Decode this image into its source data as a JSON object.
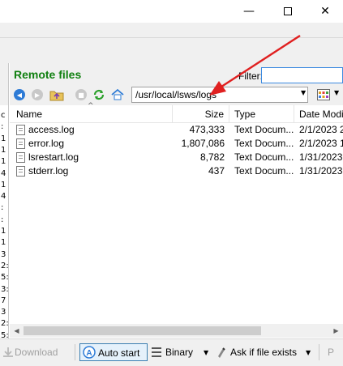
{
  "window": {
    "minimize_glyph": "—",
    "close_glyph": "✕"
  },
  "left_panel": {
    "clipped_chars": [
      "c",
      ":",
      "1",
      "1",
      "1",
      "4",
      "1",
      "4",
      ":",
      ":",
      "1",
      "1",
      "3",
      "2:",
      "5:",
      "3:",
      "7",
      "3",
      "2:",
      "5:",
      "4:"
    ]
  },
  "remote": {
    "title": "Remote files",
    "filter_label": "Filter:",
    "filter_value": "",
    "path": "/usr/local/lsws/logs",
    "toolbar_icons": [
      "back-icon",
      "forward-icon",
      "parent-folder-icon",
      "stop-icon",
      "refresh-icon",
      "home-icon",
      "view-mode-icon"
    ],
    "columns": {
      "name": "Name",
      "size": "Size",
      "type": "Type",
      "date": "Date Modifi"
    },
    "files": [
      {
        "name": "access.log",
        "size": "473,333",
        "type": "Text Docum...",
        "date": "2/1/2023 2"
      },
      {
        "name": "error.log",
        "size": "1,807,086",
        "type": "Text Docum...",
        "date": "2/1/2023 1"
      },
      {
        "name": "lsrestart.log",
        "size": "8,782",
        "type": "Text Docum...",
        "date": "1/31/2023"
      },
      {
        "name": "stderr.log",
        "size": "437",
        "type": "Text Docum...",
        "date": "1/31/2023"
      }
    ]
  },
  "bottom_toolbar": {
    "download": "Download",
    "auto_start": "Auto start",
    "binary": "Binary",
    "ask_if_exists": "Ask if file exists",
    "truncated": "P"
  },
  "colors": {
    "title_green": "#108010",
    "annotation_red": "#e02020",
    "focus_blue": "#3c8ae0"
  }
}
